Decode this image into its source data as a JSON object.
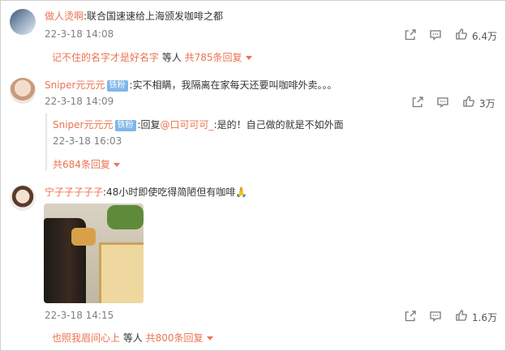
{
  "comments": [
    {
      "author": "做人烫啊",
      "text": ":联合国速速给上海颁发咖啡之都",
      "time": "22-3-18 14:08",
      "likes": "6.4万",
      "reply_summary": {
        "name": "记不住的名字才是好名字",
        "mid": " 等人 ",
        "count": "共785条回复"
      }
    },
    {
      "author": "Sniper元元元",
      "badge": "铁粉",
      "text": ":实不相瞒，我隔离在家每天还要叫咖啡外卖。。。",
      "time": "22-3-18 14:09",
      "likes": "3万",
      "reply": {
        "author": "Sniper元元元",
        "badge": "铁粉",
        "prefix": ":回复",
        "mention": "@口可可可_",
        "text": ":是的！自己做的就是不如外面",
        "time": "22-3-18 16:03",
        "count": "共684条回复"
      }
    },
    {
      "author": "宁子子子子子",
      "text": ":48小时即使吃得简陋但有咖啡🙏",
      "time": "22-3-18 14:15",
      "likes": "1.6万",
      "reply_summary": {
        "name": "也照我眉间心上",
        "mid": " 等人 ",
        "count": "共800条回复"
      }
    }
  ],
  "colors": {
    "accent": "#eb7350",
    "badge": "#7fb6e9",
    "time": "#808080"
  },
  "icons": [
    "share-icon",
    "comment-icon",
    "like-icon"
  ]
}
